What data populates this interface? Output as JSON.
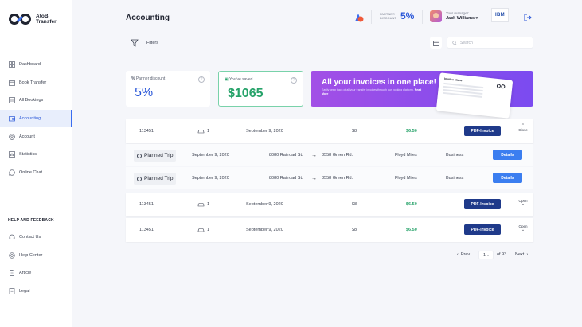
{
  "app": {
    "logo_line1": "AtoB",
    "logo_line2": "Transfer"
  },
  "sidebar": {
    "items": [
      {
        "label": "Dashboard",
        "icon": "grid-icon"
      },
      {
        "label": "Book Transfer",
        "icon": "calendar-icon"
      },
      {
        "label": "All Bookings",
        "icon": "list-icon"
      },
      {
        "label": "Accounting",
        "icon": "wallet-icon",
        "active": true
      },
      {
        "label": "Account",
        "icon": "user-icon"
      },
      {
        "label": "Statistics",
        "icon": "chart-icon"
      },
      {
        "label": "Online Chat",
        "icon": "chat-icon"
      }
    ],
    "help_title": "HELP AND FEEDBACK",
    "help_items": [
      {
        "label": "Contact Us",
        "icon": "headset-icon"
      },
      {
        "label": "Help Center",
        "icon": "lifebuoy-icon"
      },
      {
        "label": "Article",
        "icon": "document-icon"
      },
      {
        "label": "Legal",
        "icon": "legal-icon"
      }
    ]
  },
  "header": {
    "title": "Accounting",
    "partner_label_1": "PARTNER",
    "partner_label_2": "DISCOUNT",
    "partner_value": "5%",
    "manager_label": "Your manager:",
    "manager_name": "Jack Williams",
    "company_logo": "IBM"
  },
  "toolbar": {
    "filters_label": "Filters",
    "search_placeholder": "Search"
  },
  "cards": {
    "discount_label": "Partner discount",
    "discount_value": "5%",
    "saved_label": "You've saved",
    "saved_value": "$1065",
    "promo_title": "All your invoices in one place!",
    "promo_text": "Easily keep track of all your transfer invoices through our booking platform.",
    "promo_link": "Read More",
    "promo_paper_title": "Invoice Name"
  },
  "colors": {
    "accent": "#2a57d8",
    "green": "#27a36a",
    "pdf_button": "#1f3a8a",
    "details_button": "#3b7ef0",
    "promo": "#a24fe6"
  },
  "table": {
    "rows": [
      {
        "id": "113451",
        "cars": "1",
        "date": "September 9, 2020",
        "count": "$8",
        "amount": "$6.50",
        "pdf_label": "PDF-Invoice",
        "toggle_label": "Close",
        "expanded": true,
        "trips": [
          {
            "type": "Planned Trip",
            "date": "September 9, 2020",
            "from": "8080 Railroad St.",
            "to": "8558 Green Rd.",
            "person": "Floyd Miles",
            "class": "Business",
            "details_label": "Details"
          },
          {
            "type": "Planned Trip",
            "date": "September 9, 2020",
            "from": "8080 Railroad St.",
            "to": "8558 Green Rd.",
            "person": "Floyd Miles",
            "class": "Business",
            "details_label": "Details"
          }
        ]
      },
      {
        "id": "113451",
        "cars": "1",
        "date": "September 9, 2020",
        "count": "$8",
        "amount": "$6.50",
        "pdf_label": "PDF-Invoice",
        "toggle_label": "Open",
        "expanded": false
      },
      {
        "id": "113451",
        "cars": "1",
        "date": "September 9, 2020",
        "count": "$8",
        "amount": "$6.50",
        "pdf_label": "PDF-Invoice",
        "toggle_label": "Open",
        "expanded": false
      }
    ]
  },
  "pagination": {
    "prev_label": "Prev",
    "current_page": "1",
    "of_label": "of 93",
    "next_label": "Next"
  }
}
